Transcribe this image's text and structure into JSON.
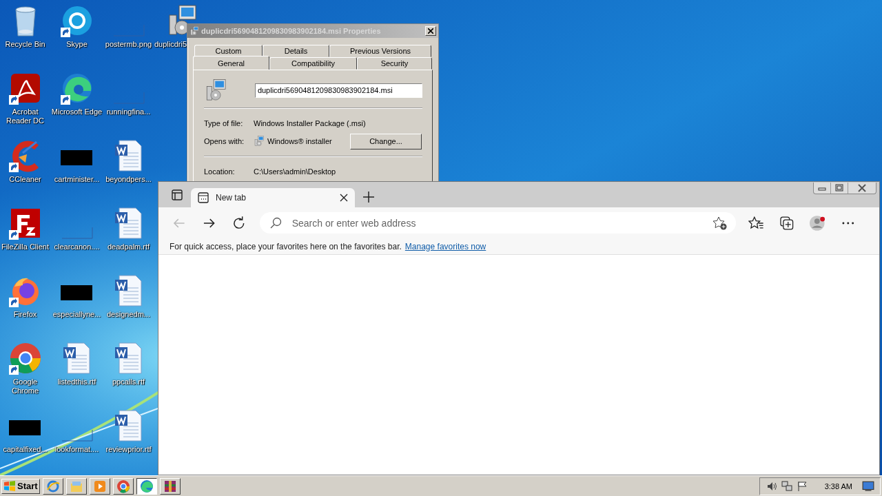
{
  "desktop": {
    "columns": [
      [
        {
          "label": "Recycle Bin",
          "kind": "recycle",
          "shortcut": false
        },
        {
          "label": "Acrobat Reader DC",
          "kind": "acrobat",
          "shortcut": true
        },
        {
          "label": "CCleaner",
          "kind": "ccleaner",
          "shortcut": true
        },
        {
          "label": "FileZilla Client",
          "kind": "filezilla",
          "shortcut": true
        },
        {
          "label": "Firefox",
          "kind": "firefox",
          "shortcut": true
        },
        {
          "label": "Google Chrome",
          "kind": "chrome",
          "shortcut": true
        },
        {
          "label": "capitalfixed...",
          "kind": "redacted",
          "shortcut": false
        }
      ],
      [
        {
          "label": "Skype",
          "kind": "skype",
          "shortcut": true
        },
        {
          "label": "Microsoft Edge",
          "kind": "edge",
          "shortcut": true
        },
        {
          "label": "cartminister...",
          "kind": "redacted",
          "shortcut": false
        },
        {
          "label": "clearcanon....",
          "kind": "blank",
          "shortcut": false
        },
        {
          "label": "especiallyne...",
          "kind": "redacted",
          "shortcut": false
        },
        {
          "label": "listedthis.rtf",
          "kind": "word",
          "shortcut": false
        },
        {
          "label": "lookformat....",
          "kind": "blank",
          "shortcut": false
        }
      ],
      [
        {
          "label": "postermb.png",
          "kind": "blank",
          "shortcut": false
        },
        {
          "label": "runningfina...",
          "kind": "blank",
          "shortcut": false
        },
        {
          "label": "beyondpers...",
          "kind": "word",
          "shortcut": false
        },
        {
          "label": "deadpalm.rtf",
          "kind": "word",
          "shortcut": false
        },
        {
          "label": "designedm...",
          "kind": "word",
          "shortcut": false
        },
        {
          "label": "ppcalls.rtf",
          "kind": "word",
          "shortcut": false
        },
        {
          "label": "reviewprior.rtf",
          "kind": "word",
          "shortcut": false
        }
      ],
      [
        {
          "label": "duplicdri5",
          "kind": "msi",
          "shortcut": false
        }
      ]
    ]
  },
  "properties_dialog": {
    "title": "duplicdri5690481209830983902184.msi Properties",
    "tab_rows": [
      [
        {
          "label": "Custom",
          "selected": false
        },
        {
          "label": "Details",
          "selected": false
        },
        {
          "label": "Previous Versions",
          "selected": false
        }
      ],
      [
        {
          "label": "General",
          "selected": true
        },
        {
          "label": "Compatibility",
          "selected": false
        },
        {
          "label": "Security",
          "selected": false
        }
      ]
    ],
    "file_name": "duplicdri5690481209830983902184.msi",
    "type_of_file": {
      "label": "Type of file:",
      "value": "Windows Installer Package (.msi)"
    },
    "opens_with": {
      "label": "Opens with:",
      "value": "Windows® installer",
      "button": "Change..."
    },
    "location": {
      "label": "Location:",
      "value": "C:\\Users\\admin\\Desktop"
    }
  },
  "browser": {
    "tabs": [
      {
        "label": "New tab",
        "selected": true
      }
    ],
    "address_placeholder": "Search or enter web address",
    "favorites_message": "For quick access, place your favorites here on the favorites bar.",
    "favorites_link": "Manage favorites now"
  },
  "taskbar": {
    "start": "Start",
    "apps": [
      {
        "kind": "ie",
        "active": false
      },
      {
        "kind": "explorer",
        "active": false
      },
      {
        "kind": "media",
        "active": false
      },
      {
        "kind": "chrome",
        "active": false
      },
      {
        "kind": "edge",
        "active": true
      },
      {
        "kind": "winrar",
        "active": false
      }
    ],
    "tray": [
      {
        "kind": "speaker"
      },
      {
        "kind": "network"
      },
      {
        "kind": "flag"
      }
    ],
    "clock": "3:38 AM"
  }
}
